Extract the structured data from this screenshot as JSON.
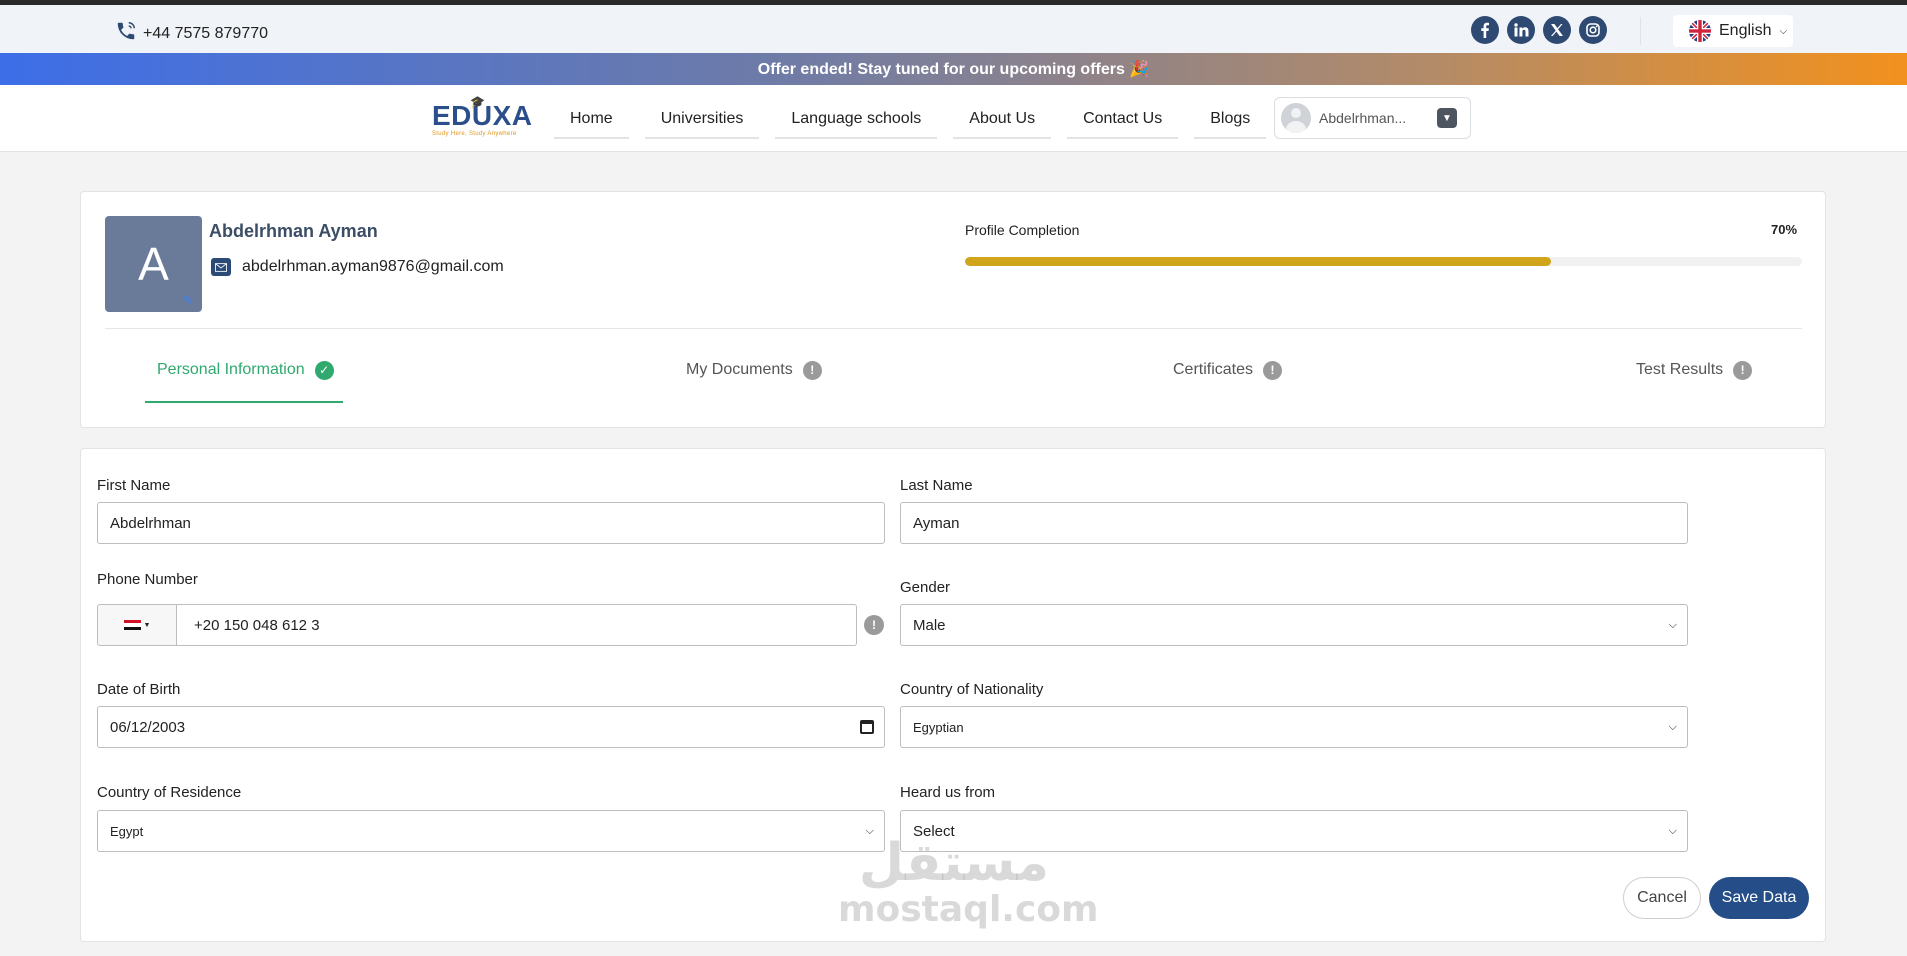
{
  "topbar": {
    "phone": "+44 7575 879770",
    "socials": [
      "facebook-icon",
      "linkedin-icon",
      "x-icon",
      "instagram-icon"
    ],
    "language": "English"
  },
  "offer_banner": "Offer ended! Stay tuned for our upcoming offers 🎉",
  "nav": {
    "logo": "EDUXA",
    "logo_tagline": "Study Here, Study Anywhere",
    "items": [
      "Home",
      "Universities",
      "Language schools",
      "About Us",
      "Contact Us",
      "Blogs"
    ],
    "user_name": "Abdelrhman..."
  },
  "profile": {
    "avatar_letter": "A",
    "name": "Abdelrhman Ayman",
    "email": "abdelrhman.ayman9876@gmail.com",
    "completion_label": "Profile Completion",
    "completion_text": "70%",
    "completion_fraction": 0.7
  },
  "tabs": [
    {
      "label": "Personal Information",
      "status": "complete"
    },
    {
      "label": "My Documents",
      "status": "incomplete"
    },
    {
      "label": "Certificates",
      "status": "incomplete"
    },
    {
      "label": "Test Results",
      "status": "incomplete"
    }
  ],
  "form": {
    "first_name": {
      "label": "First Name",
      "value": "Abdelrhman"
    },
    "last_name": {
      "label": "Last Name",
      "value": "Ayman"
    },
    "phone": {
      "label": "Phone Number",
      "value": "+20 150 048 612 3",
      "country_flag": "egypt-flag-icon"
    },
    "gender": {
      "label": "Gender",
      "value": "Male"
    },
    "dob": {
      "label": "Date of Birth",
      "value": "06/12/2003"
    },
    "nationality": {
      "label": "Country of Nationality",
      "value": "Egyptian"
    },
    "residence": {
      "label": "Country of Residence",
      "value": "Egypt"
    },
    "heard_from": {
      "label": "Heard us from",
      "value": "Select"
    },
    "cancel_label": "Cancel",
    "save_label": "Save Data"
  },
  "watermark": {
    "arabic": "مستقل",
    "latin": "mostaql.com"
  },
  "colors": {
    "brand_blue": "#254d87",
    "success_green": "#2fa96e",
    "progress_gold": "#d1a51b",
    "offer_gradient_start": "#3d6ee8",
    "offer_gradient_end": "#f2911d"
  }
}
